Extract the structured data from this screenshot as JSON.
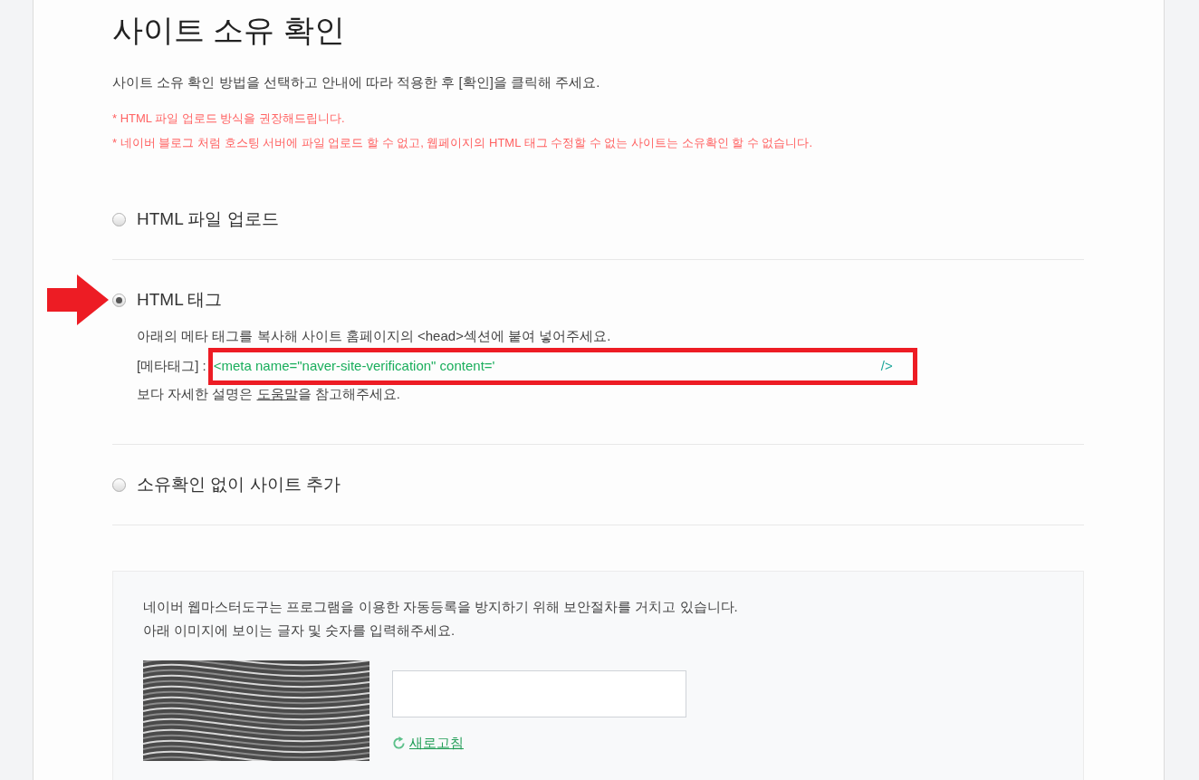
{
  "header": {
    "title": "사이트 소유 확인",
    "intro": "사이트 소유 확인 방법을 선택하고 안내에 따라 적용한 후 [확인]을 클릭해 주세요.",
    "notes": [
      "* HTML 파일 업로드 방식을 권장해드립니다.",
      "* 네이버 블로그 처럼 호스팅 서버에 파일 업로드 할 수 없고, 웹페이지의 HTML 태그 수정할 수 없는 사이트는 소유확인 할 수 없습니다."
    ]
  },
  "options": [
    {
      "kind": "plain",
      "label": "HTML 파일 업로드",
      "selected": false,
      "pointed": false
    },
    {
      "kind": "meta",
      "label": "HTML 태그",
      "selected": true,
      "pointed": true,
      "details": {
        "description": "아래의 메타 태그를 복사해 사이트 홈페이지의 <head>섹션에 붙여 넣어주세요.",
        "meta_label": "[메타태그] :",
        "meta_code": "<meta name=\"naver-site-verification\" content='",
        "meta_end": "/>",
        "highlighted": true,
        "help": {
          "before": "보다 자세한 설명은 ",
          "link": "도움말",
          "after": "을 참고해주세요."
        }
      }
    },
    {
      "kind": "plain",
      "label": "소유확인 없이 사이트 추가",
      "selected": false,
      "pointed": false
    }
  ],
  "captcha": {
    "lines": [
      "네이버 웹마스터도구는 프로그램을 이용한 자동등록을 방지하기 위해 보안절차를 거치고 있습니다.",
      "아래 이미지에 보이는 글자 및 숫자를 입력해주세요."
    ],
    "refresh": "새로고침"
  }
}
